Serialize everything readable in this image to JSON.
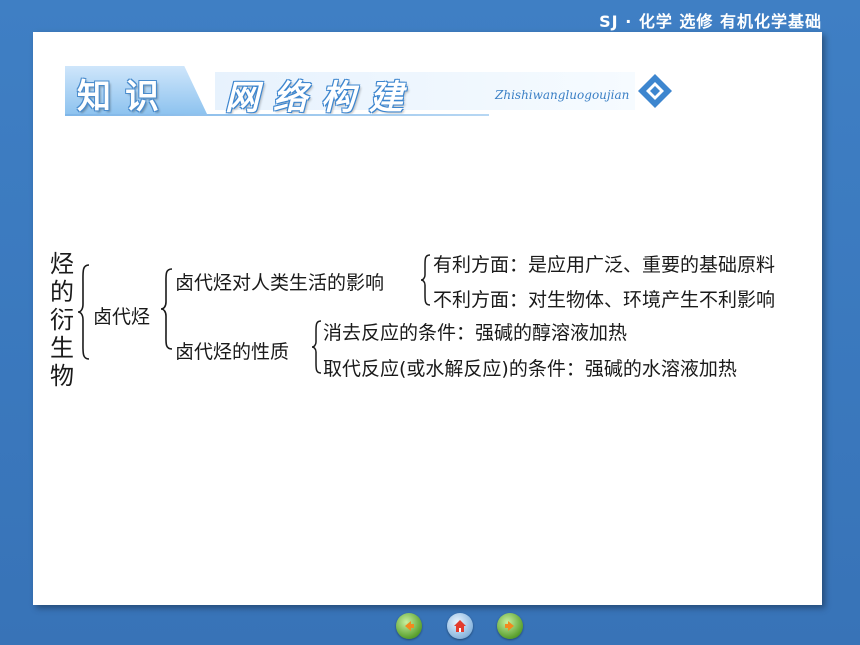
{
  "header": {
    "course_title": "SJ · 化学  选修  有机化学基础"
  },
  "banner": {
    "left_text": "知识",
    "right_text": "网络构建",
    "pinyin": "Zhishiwangluogoujian",
    "logo_icon": "diamond-logo-icon"
  },
  "tree": {
    "root": "烃的衍生物",
    "level1": "卤代烃",
    "branch_a": {
      "label": "卤代烃对人类生活的影响",
      "items": [
        "有利方面：是应用广泛、重要的基础原料",
        "不利方面：对生物体、环境产生不利影响"
      ]
    },
    "branch_b": {
      "label": "卤代烃的性质",
      "items": [
        "消去反应的条件：强碱的醇溶液加热",
        "取代反应(或水解反应)的条件：强碱的水溶液加热"
      ]
    }
  },
  "nav": {
    "prev_icon": "prev-arrow-icon",
    "home_icon": "home-icon",
    "next_icon": "next-arrow-icon"
  },
  "colors": {
    "background": "#3f7fc4",
    "banner_blue": "#3d86cf",
    "text": "#1a1a1a"
  }
}
